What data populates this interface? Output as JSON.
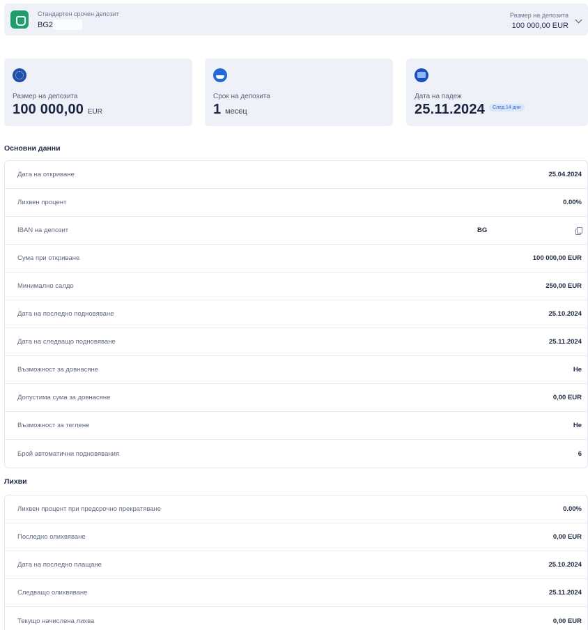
{
  "header": {
    "account_type": "Стандартен срочен депозит",
    "account_iban": "BG2",
    "deposit_size_label": "Размер на депозита",
    "deposit_size_value": "100 000,00 EUR"
  },
  "cards": {
    "amount": {
      "label": "Размер на депозита",
      "value": "100 000,00",
      "unit": "EUR",
      "icon": "eu-flag-icon"
    },
    "term": {
      "label": "Срок на депозита",
      "value": "1",
      "unit": "месец",
      "icon": "term-icon"
    },
    "maturity": {
      "label": "Дата на падеж",
      "value": "25.11.2024",
      "badge": "След 14 дни",
      "icon": "calendar-icon"
    }
  },
  "main_data": {
    "title": "Основни данни",
    "rows": [
      {
        "label": "Дата на откриване",
        "value": "25.04.2024"
      },
      {
        "label": "Лихвен процент",
        "value": "0.00%"
      },
      {
        "label": "IBAN на депозит",
        "value": "BG"
      },
      {
        "label": "Сума при откриване",
        "value": "100 000,00 EUR"
      },
      {
        "label": "Минимално салдо",
        "value": "250,00 EUR"
      },
      {
        "label": "Дата на последно подновяване",
        "value": "25.10.2024"
      },
      {
        "label": "Дата на следващо подновяване",
        "value": "25.11.2024"
      },
      {
        "label": "Възможност за довнасяне",
        "value": "Не"
      },
      {
        "label": "Допустима сума за довнасяне",
        "value": "0,00 EUR"
      },
      {
        "label": "Възможност за теглене",
        "value": "Не"
      },
      {
        "label": "Брой автоматични подновявания",
        "value": "6"
      }
    ]
  },
  "interest": {
    "title": "Лихви",
    "rows": [
      {
        "label": "Лихвен процент при предсрочно прекратяване",
        "value": "0.00%"
      },
      {
        "label": "Последно олихвяване",
        "value": "0,00 EUR"
      },
      {
        "label": "Дата на последно плащане",
        "value": "25.10.2024"
      },
      {
        "label": "Следващо олихвяване",
        "value": "25.11.2024"
      },
      {
        "label": "Текущо начислена лихва",
        "value": "0,00 EUR"
      }
    ]
  }
}
